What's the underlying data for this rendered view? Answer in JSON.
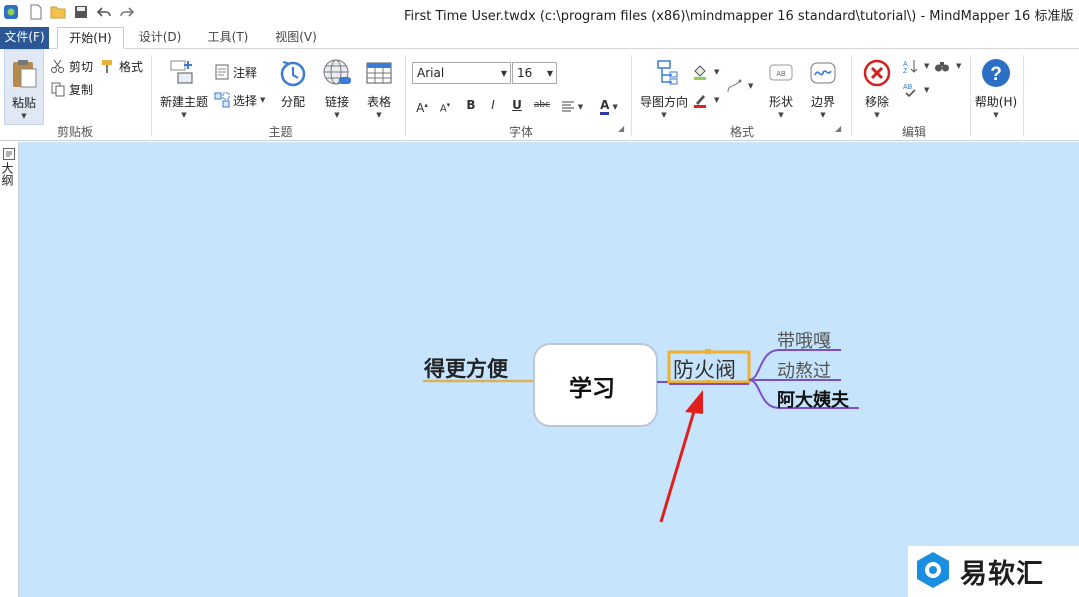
{
  "window": {
    "title": "First Time User.twdx (c:\\program files (x86)\\mindmapper 16 standard\\tutorial\\) - MindMapper 16 标准版"
  },
  "tabs": [
    {
      "label": "文件(F)"
    },
    {
      "label": "开始(H)"
    },
    {
      "label": "设计(D)"
    },
    {
      "label": "工具(T)"
    },
    {
      "label": "视图(V)"
    }
  ],
  "ribbon": {
    "clipboard": {
      "paste": "粘贴",
      "cut": "剪切",
      "format": "格式",
      "copy": "复制",
      "group": "剪贴板"
    },
    "topic": {
      "new_topic": "新建主题",
      "note": "注释",
      "select": "选择",
      "distribute": "分配",
      "link": "链接",
      "table": "表格",
      "group": "主题"
    },
    "font": {
      "family": "Arial",
      "size": "16",
      "group": "字体",
      "bold": "B",
      "italic": "I",
      "underline": "U",
      "strike": "abc"
    },
    "format": {
      "map_direction": "导图方向",
      "shape": "形状",
      "border": "边界",
      "group": "格式"
    },
    "edit": {
      "remove": "移除",
      "group": "编辑"
    },
    "help": {
      "label": "帮助(H)"
    }
  },
  "sidebar": {
    "outline_label": "大纲"
  },
  "map": {
    "central": "学习",
    "left_topic": "得更方便",
    "selected_topic": "防火阀",
    "subtopics": [
      "带哦嘎",
      "动熬过",
      "阿大姨夫"
    ]
  },
  "watermark": {
    "text": "易软汇"
  },
  "colors": {
    "canvas": "#c6e4fb",
    "file_tab": "#2b5797",
    "selection": "#f0b030",
    "annotation_arrow": "#e01e1e",
    "branch_purple": "#7b4fc9"
  }
}
